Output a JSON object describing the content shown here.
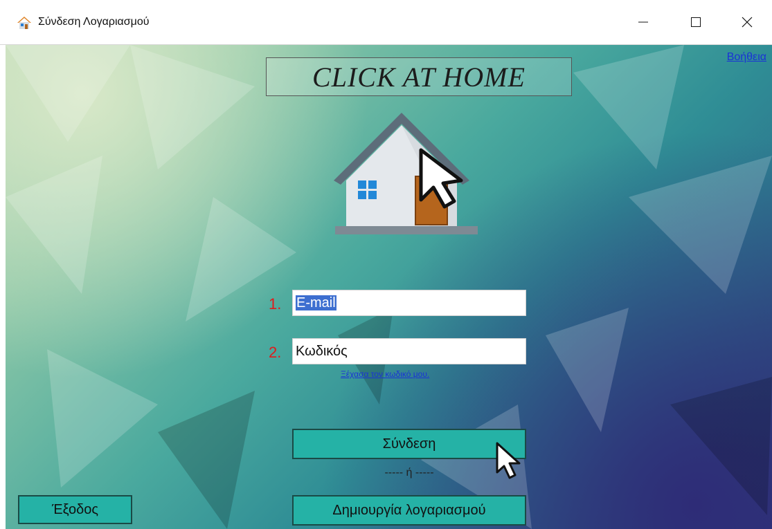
{
  "window": {
    "title": "Σύνδεση Λογαριασμού",
    "icon": "house-icon"
  },
  "header": {
    "help_link": "Βοήθεια",
    "logo_text": "CLICK AT HOME"
  },
  "form": {
    "step1_label": "1.",
    "step2_label": "2.",
    "email_value": "E-mail",
    "password_value": "Κωδικός",
    "forgot_link": "Ξέχασα τον κωδικό μου."
  },
  "actions": {
    "login_label": "Σύνδεση",
    "separator": "----- ή -----",
    "create_account_label": "Δημιουργία λογαριασμού",
    "exit_label": "Έξοδος"
  },
  "colors": {
    "button_bg": "#25b2a6",
    "link": "#1a32d6",
    "step_number": "#e01c1c"
  }
}
